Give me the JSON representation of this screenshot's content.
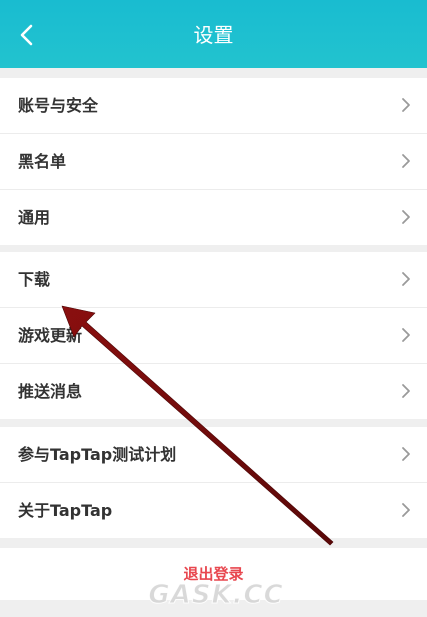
{
  "header": {
    "title": "设置",
    "back_icon": "chevron-left-icon"
  },
  "groups": [
    {
      "items": [
        {
          "label": "账号与安全"
        },
        {
          "label": "黑名单"
        },
        {
          "label": "通用"
        }
      ]
    },
    {
      "items": [
        {
          "label": "下载"
        },
        {
          "label": "游戏更新"
        },
        {
          "label": "推送消息"
        }
      ]
    },
    {
      "items": [
        {
          "label": "参与TapTap测试计划"
        },
        {
          "label": "关于TapTap"
        }
      ]
    }
  ],
  "logout": {
    "label": "退出登录"
  },
  "watermark": "GASK.CC",
  "colors": {
    "header": "#1ebfd0",
    "logout": "#e8474f",
    "annotation_arrow": "#7d1010"
  }
}
